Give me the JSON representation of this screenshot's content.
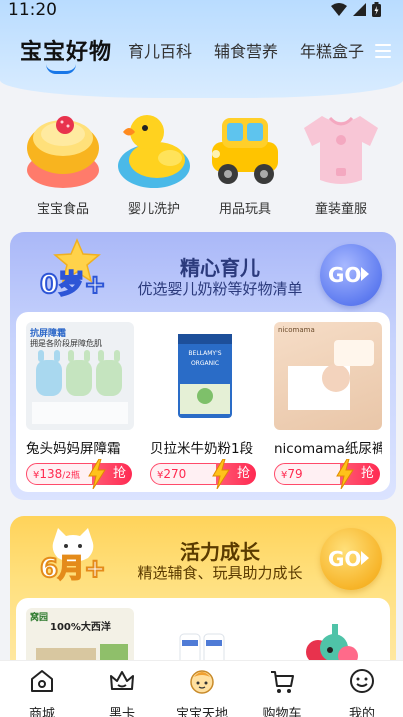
{
  "status": {
    "time": "11:20"
  },
  "header": {
    "brand": "宝宝好物",
    "tabs": [
      "育儿百科",
      "辅食营养",
      "年糕盒子"
    ]
  },
  "categories": [
    {
      "label": "宝宝食品",
      "icon": "pudding-bowl-icon"
    },
    {
      "label": "婴儿洗护",
      "icon": "rubber-duck-icon"
    },
    {
      "label": "用品玩具",
      "icon": "toy-car-icon"
    },
    {
      "label": "童装童服",
      "icon": "baby-onesie-icon"
    }
  ],
  "promo1": {
    "badge": "0岁+",
    "title": "精心育儿",
    "subtitle": "优选婴儿奶粉等好物清单",
    "go": "GO",
    "products": [
      {
        "name": "兔头妈妈屏障霜",
        "currency": "¥",
        "price": "138",
        "unit": "/2瓶",
        "action": "抢",
        "img_text": [
          "抗屏障霜",
          "拥是各阶段屏障危肌"
        ]
      },
      {
        "name": "贝拉米牛奶粉1段",
        "currency": "¥",
        "price": "270",
        "unit": "",
        "action": "抢",
        "img_text": [
          "BELLAMY'S",
          "ORGANIC"
        ]
      },
      {
        "name": "nicomama纸尿裤",
        "currency": "¥",
        "price": "79",
        "unit": "",
        "action": "抢",
        "img_text": [
          "nicomama"
        ]
      }
    ]
  },
  "promo2": {
    "badge": "6月+",
    "title": "活力成长",
    "subtitle": "精选辅食、玩具助力成长",
    "go": "GO",
    "products": [
      {
        "img_text": [
          "窝园",
          "100%大西洋"
        ]
      }
    ]
  },
  "tabbar": [
    {
      "label": "商城",
      "icon": "home-icon"
    },
    {
      "label": "黑卡",
      "icon": "crown-icon"
    },
    {
      "label": "宝宝天地",
      "icon": "baby-face-icon"
    },
    {
      "label": "购物车",
      "icon": "cart-icon"
    },
    {
      "label": "我的",
      "icon": "profile-icon"
    }
  ],
  "colors": {
    "accent_blue": "#1877e8",
    "price_red": "#ff2a50",
    "card1_bg": "#c7d3fc",
    "card2_bg": "#ffe07e"
  }
}
